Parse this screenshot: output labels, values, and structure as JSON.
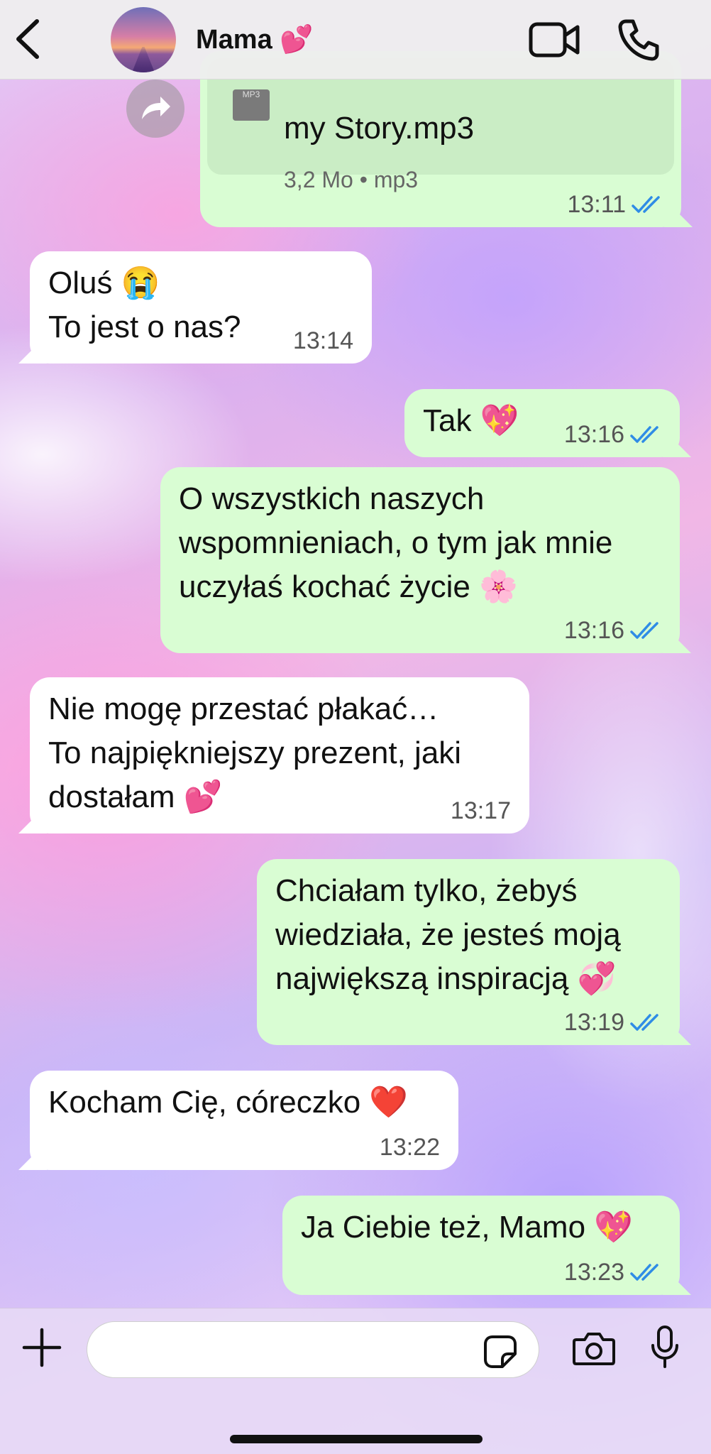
{
  "header": {
    "contact_name": "Mama 💕",
    "back_icon": "chevron-left-icon",
    "video_icon": "video-camera-icon",
    "phone_icon": "phone-icon"
  },
  "messages": [
    {
      "type": "file",
      "direction": "outgoing",
      "thumb_label": "MP3",
      "file_name": "my Story.mp3",
      "file_info": "3,2 Mo • mp3",
      "time": "13:11",
      "read": true
    },
    {
      "direction": "incoming",
      "text": "Oluś 😭\nTo jest o nas?",
      "time": "13:14"
    },
    {
      "direction": "outgoing",
      "text": "Tak 💖",
      "time": "13:16",
      "read": true
    },
    {
      "direction": "outgoing",
      "text": "O wszystkich naszych\nwspomnieniach, o tym jak mnie\nuczyłaś kochać życie 🌸",
      "time": "13:16",
      "read": true
    },
    {
      "direction": "incoming",
      "text": "Nie mogę przestać płakać…\nTo najpiękniejszy prezent, jaki\ndostałam 💕",
      "time": "13:17"
    },
    {
      "direction": "outgoing",
      "text": "Chciałam tylko, żebyś\nwiedziała, że jesteś moją\nnajwiększą inspiracją 💞",
      "time": "13:19",
      "read": true
    },
    {
      "direction": "incoming",
      "text": "Kocham Cię, córeczko ❤️",
      "time": "13:22"
    },
    {
      "direction": "outgoing",
      "text": "Ja Ciebie też, Mamo 💖",
      "time": "13:23",
      "read": true
    }
  ],
  "composer": {
    "placeholder": "",
    "plus_icon": "plus-icon",
    "sticker_icon": "sticker-icon",
    "camera_icon": "camera-icon",
    "mic_icon": "microphone-icon"
  },
  "colors": {
    "outgoing_bubble": "#d9fdd3",
    "incoming_bubble": "#ffffff",
    "read_ticks": "#2f8ce6"
  }
}
